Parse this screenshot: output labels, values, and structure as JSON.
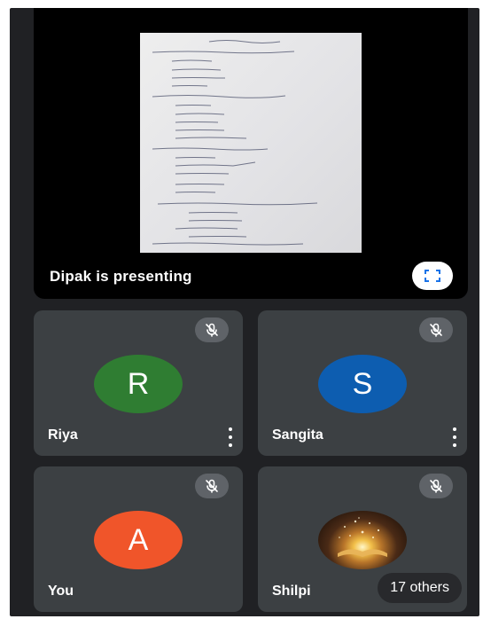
{
  "presentation": {
    "label": "Dipak is presenting",
    "fullscreen_icon": "fullscreen-icon"
  },
  "participants": [
    {
      "name": "Riya",
      "initial": "R",
      "color": "#2f7d32",
      "muted": true
    },
    {
      "name": "Sangita",
      "initial": "S",
      "color": "#0d5db0",
      "muted": true
    },
    {
      "name": "You",
      "initial": "A",
      "color": "#f0552a",
      "muted": true
    },
    {
      "name": "Shilpi",
      "initial": "",
      "muted": true,
      "others_label": "17 others"
    }
  ],
  "colors": {
    "background": "#202124",
    "tile": "#3c4043",
    "mic_badge": "#5f6368"
  }
}
